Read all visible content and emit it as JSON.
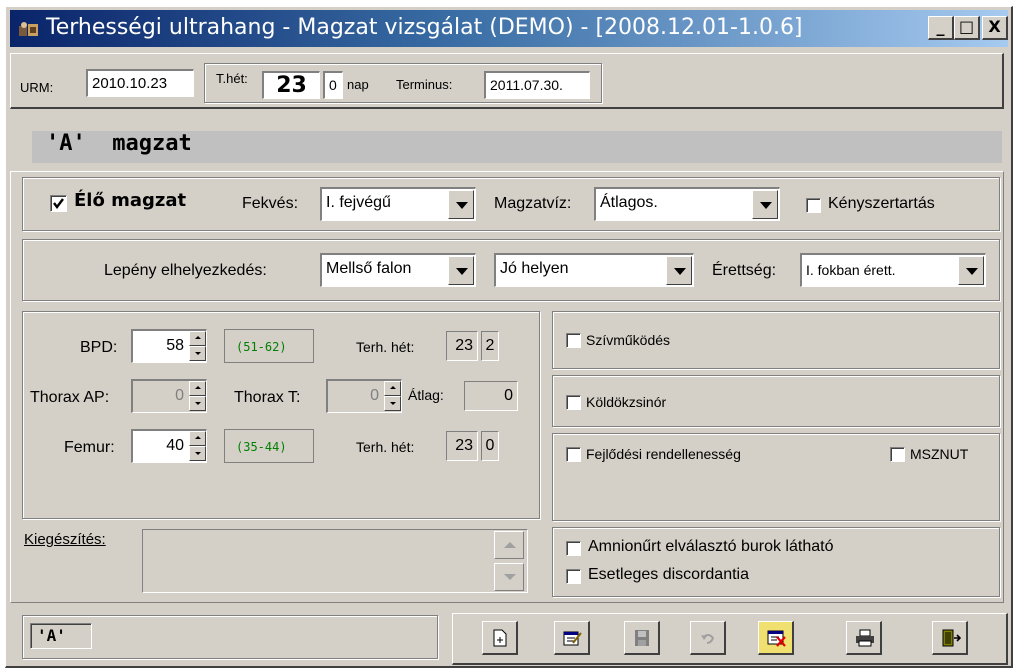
{
  "window": {
    "title": "Terhességi ultrahang - Magzat vizsgálat (DEMO) - [2008.12.01-1.0.6]",
    "buttons": {
      "minimize": "_",
      "maximize": "□",
      "close": "X"
    }
  },
  "header": {
    "urm_label": "URM:",
    "urm_value": "2010.10.23",
    "thet_label": "T.hét:",
    "thet_weeks": "23",
    "thet_days": "0",
    "nap_label": "nap",
    "terminus_label": "Terminus:",
    "terminus_value": "2011.07.30."
  },
  "fetus": {
    "title": "'A'  magzat",
    "alive_label": "Élő magzat",
    "alive_checked": true,
    "fekves_label": "Fekvés:",
    "fekves_value": "I. fejvégű",
    "magzatviz_label": "Magzatvíz:",
    "magzatviz_value": "Átlagos.",
    "kenyszer_label": "Kényszertartás"
  },
  "placenta": {
    "label": "Lepény elhelyezkedés:",
    "position_value": "Mellső falon",
    "location_value": "Jó helyen",
    "erettseg_label": "Érettség:",
    "erettseg_value": "I. fokban érett."
  },
  "measurements": {
    "bpd_label": "BPD:",
    "bpd_value": "58",
    "bpd_range": "(51-62)",
    "bpd_week_label": "Terh. hét:",
    "bpd_week": "23",
    "bpd_day": "2",
    "thorax_ap_label": "Thorax AP:",
    "thorax_ap_value": "0",
    "thorax_t_label": "Thorax T:",
    "thorax_t_value": "0",
    "atlag_label": "Átlag:",
    "atlag_value": "0",
    "femur_label": "Femur:",
    "femur_value": "40",
    "femur_range": "(35-44)",
    "femur_week_label": "Terh. hét:",
    "femur_week": "23",
    "femur_day": "0"
  },
  "checks": {
    "szivmukodes": "Szívműködés",
    "koldokzsinor": "Köldökzsinór",
    "fejlodesi": "Fejlődési rendellenesség",
    "msznut": "MSZNUT",
    "amnion": "Amnionűrt elválasztó burok látható",
    "discordantia": "Esetleges discordantia"
  },
  "notes": {
    "label": "Kiegészítés:",
    "value": ""
  },
  "footer": {
    "fetus_tab": "'A'"
  },
  "colors": {
    "face": "#d4d0c8",
    "title_start": "#0a246a",
    "title_end": "#a6caf0",
    "range_text": "#008000"
  }
}
